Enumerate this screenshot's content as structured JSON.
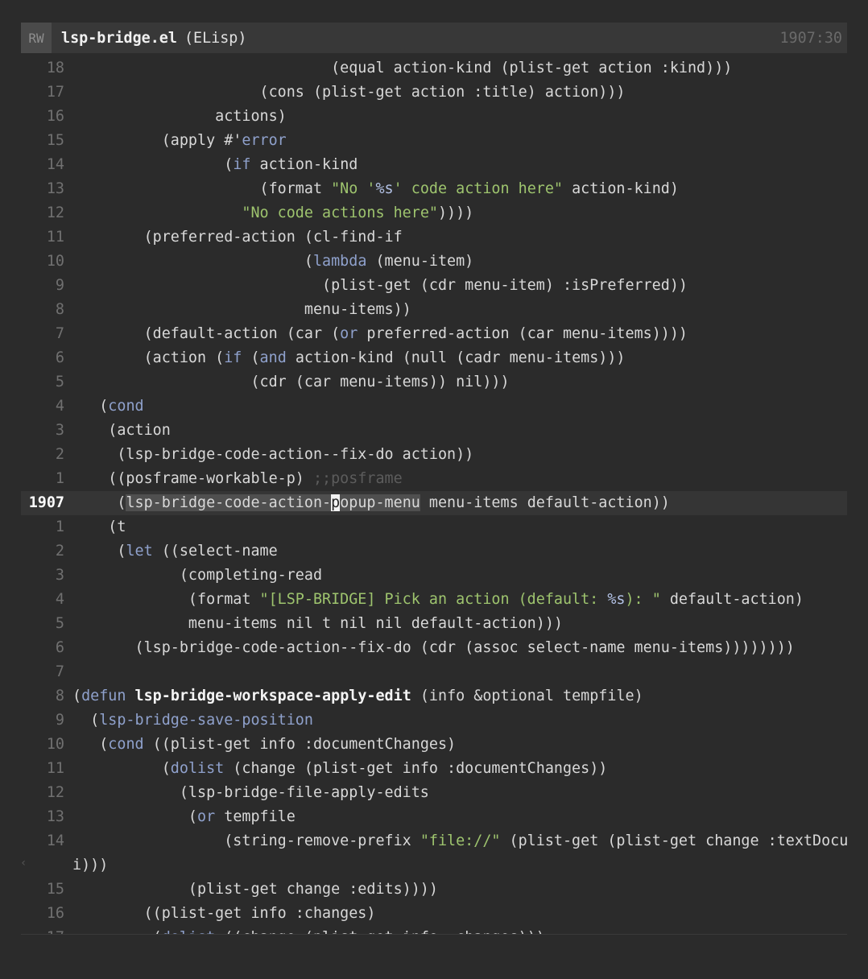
{
  "modeline": {
    "status": "RW",
    "buffer_name": "lsp-bridge.el",
    "major_mode": "(ELisp)",
    "position": "1907:30"
  },
  "wrap_indicator": "‹",
  "lines": [
    {
      "ln": "18",
      "code": [
        [
          "                             (equal action-kind (plist-get action :kind)))",
          ""
        ]
      ]
    },
    {
      "ln": "17",
      "code": [
        [
          "                     (cons (plist-get action :title) action)))",
          ""
        ]
      ]
    },
    {
      "ln": "16",
      "code": [
        [
          "                actions)",
          ""
        ]
      ]
    },
    {
      "ln": "15",
      "code": [
        [
          "          (apply #'",
          ""
        ],
        [
          "error",
          "kw"
        ]
      ]
    },
    {
      "ln": "14",
      "code": [
        [
          "                 (",
          ""
        ],
        [
          "if",
          "kw"
        ],
        [
          " action-kind",
          ""
        ]
      ]
    },
    {
      "ln": "13",
      "code": [
        [
          "                     (format ",
          ""
        ],
        [
          "\"No '",
          "str"
        ],
        [
          "%s",
          "fmt"
        ],
        [
          "' code action here\"",
          "str"
        ],
        [
          " action-kind)",
          ""
        ]
      ]
    },
    {
      "ln": "12",
      "code": [
        [
          "                   ",
          ""
        ],
        [
          "\"No code actions here\"",
          "str"
        ],
        [
          "))))",
          ""
        ]
      ]
    },
    {
      "ln": "11",
      "code": [
        [
          "        (preferred-action (cl-find-if",
          ""
        ]
      ]
    },
    {
      "ln": "10",
      "code": [
        [
          "                          (",
          ""
        ],
        [
          "lambda",
          "kw"
        ],
        [
          " (menu-item)",
          ""
        ]
      ]
    },
    {
      "ln": "9",
      "code": [
        [
          "                            (plist-get (cdr menu-item) :isPreferred))",
          ""
        ]
      ]
    },
    {
      "ln": "8",
      "code": [
        [
          "                          menu-items))",
          ""
        ]
      ]
    },
    {
      "ln": "7",
      "code": [
        [
          "        (default-action (car (",
          ""
        ],
        [
          "or",
          "kw"
        ],
        [
          " preferred-action (car menu-items))))",
          ""
        ]
      ]
    },
    {
      "ln": "6",
      "code": [
        [
          "        (action (",
          ""
        ],
        [
          "if",
          "kw"
        ],
        [
          " (",
          ""
        ],
        [
          "and",
          "kw"
        ],
        [
          " action-kind (null (cadr menu-items)))",
          ""
        ]
      ]
    },
    {
      "ln": "5",
      "code": [
        [
          "                    (cdr (car menu-items)) nil)))",
          ""
        ]
      ]
    },
    {
      "ln": "4",
      "code": [
        [
          "   (",
          ""
        ],
        [
          "cond",
          "kw"
        ]
      ]
    },
    {
      "ln": "3",
      "code": [
        [
          "    (action",
          ""
        ]
      ]
    },
    {
      "ln": "2",
      "code": [
        [
          "     (lsp-bridge-code-action--fix-do action))",
          ""
        ]
      ]
    },
    {
      "ln": "1",
      "code": [
        [
          "    ((posframe-workable-p) ",
          ""
        ],
        [
          ";;posframe",
          "cmt"
        ]
      ]
    },
    {
      "ln": "1907",
      "current": true,
      "code": [
        [
          "     (",
          ""
        ],
        [
          "lsp-bridge-code-action-",
          "sel"
        ],
        [
          "p",
          "cursor"
        ],
        [
          "opup-menu",
          "sel"
        ],
        [
          " menu-items default-action))",
          ""
        ]
      ]
    },
    {
      "ln": "1",
      "code": [
        [
          "    (t",
          ""
        ]
      ]
    },
    {
      "ln": "2",
      "code": [
        [
          "     (",
          ""
        ],
        [
          "let",
          "kw"
        ],
        [
          " ((select-name",
          ""
        ]
      ]
    },
    {
      "ln": "3",
      "code": [
        [
          "            (completing-read",
          ""
        ]
      ]
    },
    {
      "ln": "4",
      "code": [
        [
          "             (format ",
          ""
        ],
        [
          "\"[LSP-BRIDGE] Pick an action (default: ",
          "str"
        ],
        [
          "%s",
          "fmt"
        ],
        [
          "): \"",
          "str"
        ],
        [
          " default-action)",
          ""
        ]
      ]
    },
    {
      "ln": "5",
      "code": [
        [
          "             menu-items nil t nil nil default-action)))",
          ""
        ]
      ]
    },
    {
      "ln": "6",
      "code": [
        [
          "       (lsp-bridge-code-action--fix-do (cdr (assoc select-name menu-items))))))))",
          ""
        ]
      ]
    },
    {
      "ln": "7",
      "code": [
        [
          "",
          ""
        ]
      ]
    },
    {
      "ln": "8",
      "code": [
        [
          "(",
          ""
        ],
        [
          "defun",
          "kw"
        ],
        [
          " ",
          ""
        ],
        [
          "lsp-bridge-workspace-apply-edit",
          "fn"
        ],
        [
          " (info &optional tempfile)",
          ""
        ]
      ]
    },
    {
      "ln": "9",
      "code": [
        [
          "  (",
          ""
        ],
        [
          "lsp-bridge-save-position",
          "kw"
        ]
      ]
    },
    {
      "ln": "10",
      "code": [
        [
          "   (",
          ""
        ],
        [
          "cond",
          "kw"
        ],
        [
          " ((plist-get info :documentChanges)",
          ""
        ]
      ]
    },
    {
      "ln": "11",
      "code": [
        [
          "          (",
          ""
        ],
        [
          "dolist",
          "kw"
        ],
        [
          " (change (plist-get info :documentChanges))",
          ""
        ]
      ]
    },
    {
      "ln": "12",
      "code": [
        [
          "            (lsp-bridge-file-apply-edits",
          ""
        ]
      ]
    },
    {
      "ln": "13",
      "code": [
        [
          "             (",
          ""
        ],
        [
          "or",
          "kw"
        ],
        [
          " tempfile",
          ""
        ]
      ]
    },
    {
      "ln": "14",
      "code": [
        [
          "                 (string-remove-prefix ",
          ""
        ],
        [
          "\"file://\"",
          "str"
        ],
        [
          " (plist-get (plist-get change :textDocument) :ur",
          ""
        ]
      ]
    },
    {
      "ln": "",
      "code": [
        [
          "i)))",
          ""
        ]
      ]
    },
    {
      "ln": "15",
      "code": [
        [
          "             (plist-get change :edits))))",
          ""
        ]
      ]
    },
    {
      "ln": "16",
      "code": [
        [
          "        ((plist-get info :changes)",
          ""
        ]
      ]
    },
    {
      "ln": "17",
      "code": [
        [
          "         (",
          ""
        ],
        [
          "dolist",
          "kw"
        ],
        [
          " ((change (plist-get info :changes)))",
          ""
        ]
      ]
    }
  ]
}
